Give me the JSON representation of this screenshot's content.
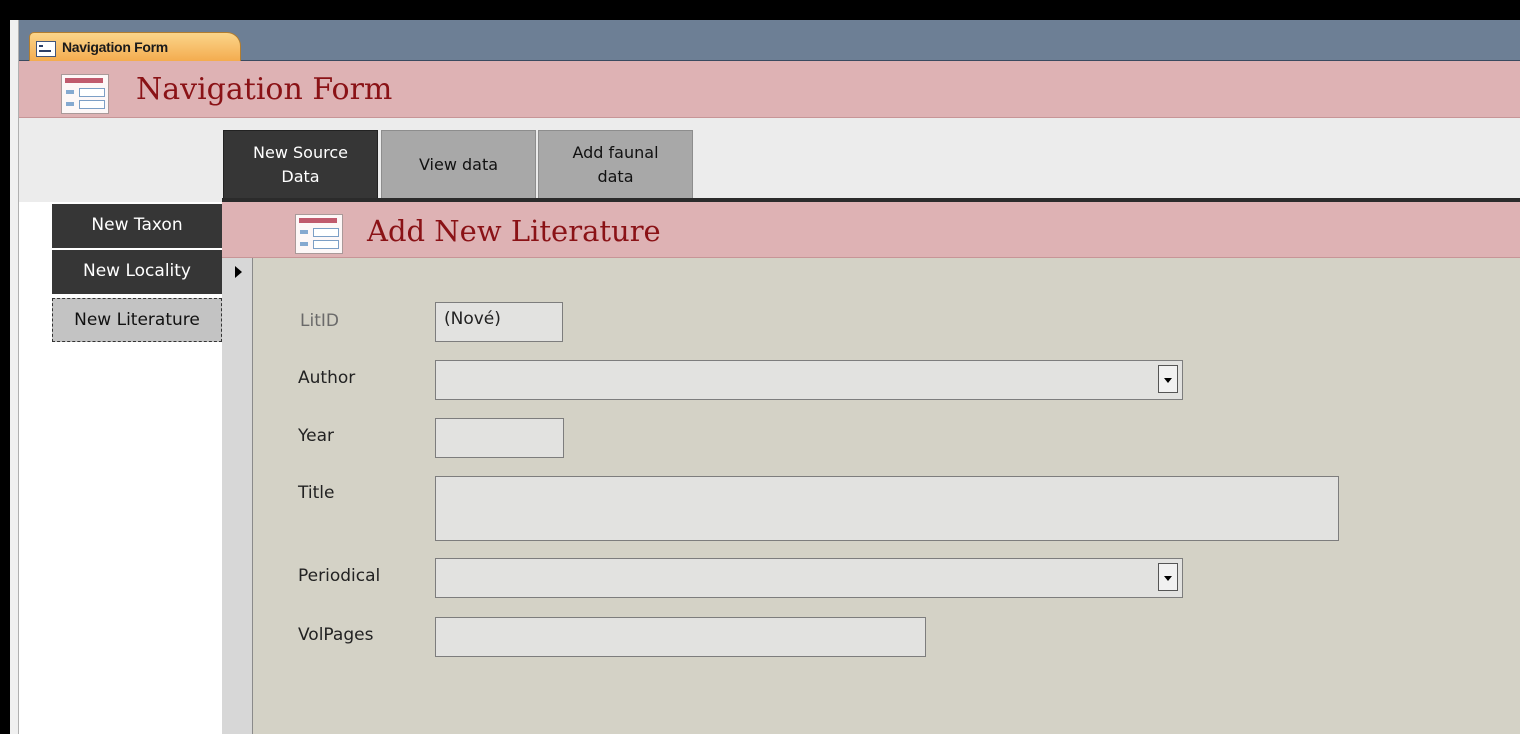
{
  "document_tab": {
    "label": "Navigation Form",
    "icon": "form-icon"
  },
  "header": {
    "title": "Navigation Form",
    "icon": "form-icon"
  },
  "tabs": [
    {
      "label_line1": "New Source",
      "label_line2": "Data",
      "active": true
    },
    {
      "label_line1": "View data",
      "label_line2": "",
      "active": false
    },
    {
      "label_line1": "Add faunal",
      "label_line2": "data",
      "active": false
    }
  ],
  "left_nav": [
    {
      "label": "New Taxon",
      "selected": false
    },
    {
      "label": "New Locality",
      "selected": false
    },
    {
      "label": "New Literature",
      "selected": true
    }
  ],
  "subform": {
    "title": "Add New Literature",
    "icon": "form-icon",
    "fields": {
      "litid": {
        "label": "LitID",
        "value": "(Nové)"
      },
      "author": {
        "label": "Author",
        "value": ""
      },
      "year": {
        "label": "Year",
        "value": ""
      },
      "title": {
        "label": "Title",
        "value": ""
      },
      "periodical": {
        "label": "Periodical",
        "value": ""
      },
      "volpages": {
        "label": "VolPages",
        "value": ""
      }
    }
  },
  "colors": {
    "header_bg": "#deb2b4",
    "title_text": "#8a1216",
    "active_tab": "#363636",
    "inactive_tab": "#a8a8a8",
    "form_bg": "#d4d2c6",
    "doc_tab": "#f3a94b"
  }
}
